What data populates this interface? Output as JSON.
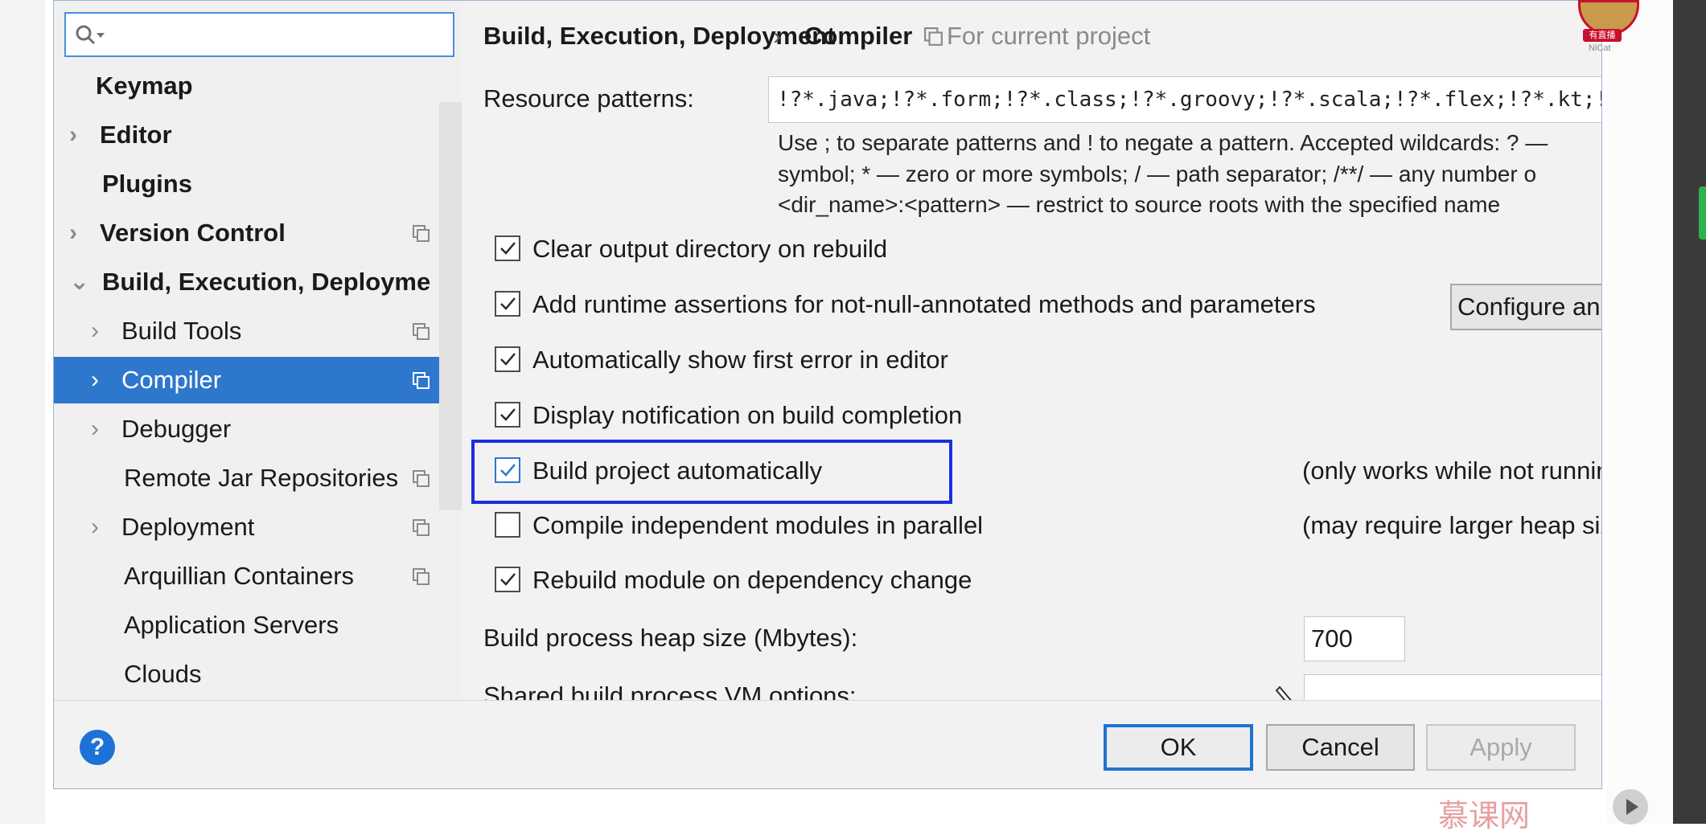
{
  "sidebar": {
    "search_placeholder": "",
    "items": [
      {
        "label": "Keymap",
        "arrow": ""
      },
      {
        "label": "Editor",
        "arrow": "›"
      },
      {
        "label": "Plugins",
        "arrow": ""
      },
      {
        "label": "Version Control",
        "arrow": "›"
      },
      {
        "label": "Build, Execution, Deployment",
        "arrow": "⌄"
      },
      {
        "label": "Build Tools",
        "arrow": "›"
      },
      {
        "label": "Compiler",
        "arrow": "›"
      },
      {
        "label": "Debugger",
        "arrow": "›"
      },
      {
        "label": "Remote Jar Repositories",
        "arrow": ""
      },
      {
        "label": "Deployment",
        "arrow": "›"
      },
      {
        "label": "Arquillian Containers",
        "arrow": ""
      },
      {
        "label": "Application Servers",
        "arrow": ""
      },
      {
        "label": "Clouds",
        "arrow": ""
      }
    ]
  },
  "breadcrumb": {
    "parent": "Build, Execution, Deployment",
    "separator": "›",
    "current": "Compiler",
    "scope": "For current project"
  },
  "compiler": {
    "resource_label": "Resource patterns:",
    "resource_value": "!?*.java;!?*.form;!?*.class;!?*.groovy;!?*.scala;!?*.flex;!?*.kt;!?*.clj",
    "hint_line1": "Use ; to separate patterns and ! to negate a pattern. Accepted wildcards: ? —",
    "hint_line2": "symbol; * — zero or more symbols; / — path separator; /**/ — any number o",
    "hint_line3": "<dir_name>:<pattern> — restrict to source roots with the specified name",
    "options": [
      {
        "label": "Clear output directory on rebuild",
        "checked": true
      },
      {
        "label": "Add runtime assertions for not-null-annotated methods and parameters",
        "checked": true
      },
      {
        "label": "Automatically show first error in editor",
        "checked": true
      },
      {
        "label": "Display notification on build completion",
        "checked": true
      },
      {
        "label": "Build project automatically",
        "checked": true
      },
      {
        "label": "Compile independent modules in parallel",
        "checked": false
      },
      {
        "label": "Rebuild module on dependency change",
        "checked": true
      }
    ],
    "configure_label": "Configure anno",
    "note_auto": "(only works while not running",
    "note_parallel": "(may require larger heap size)",
    "heap_label": "Build process heap size (Mbytes):",
    "heap_value": "700",
    "vm_label": "Shared build process VM options:",
    "vm_value": ""
  },
  "footer": {
    "help_label": "?",
    "ok_label": "OK",
    "cancel_label": "Cancel",
    "apply_label": "Apply"
  },
  "overlay": {
    "live_badge": "有直播",
    "live_name": "NiCat",
    "watermark": "慕课网"
  },
  "colors": {
    "selection": "#2d77cc",
    "highlight_box": "#1b2ee0",
    "help": "#1c72d6"
  }
}
